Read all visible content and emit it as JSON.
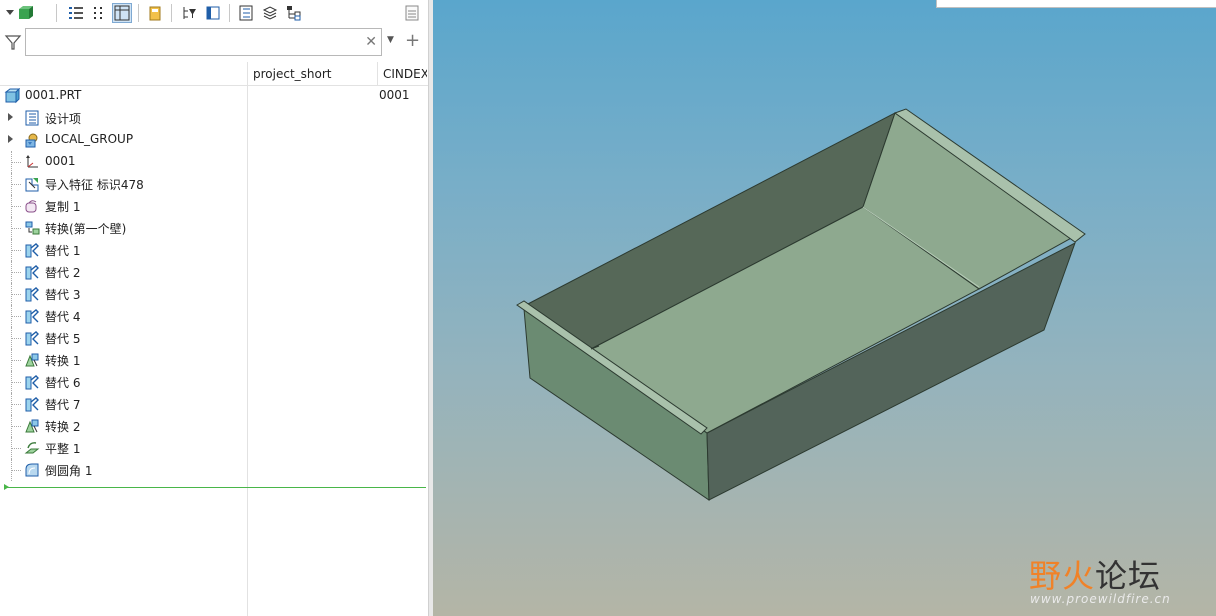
{
  "model_tree": {
    "search": {
      "value": "",
      "placeholder": ""
    },
    "columns": [
      "project_short",
      "CINDEX"
    ],
    "root": {
      "name": "0001.PRT",
      "cindex": "0001"
    },
    "items": [
      {
        "label": "设计项",
        "icon": "design-items-icon",
        "expandable": true
      },
      {
        "label": "LOCAL_GROUP",
        "icon": "group-icon",
        "expandable": true
      },
      {
        "label": "0001",
        "icon": "coordinate-system-icon",
        "expandable": false
      },
      {
        "label": "导入特征 标识478",
        "icon": "import-feature-icon",
        "expandable": false
      },
      {
        "label": "复制 1",
        "icon": "copy-feature-icon",
        "expandable": false
      },
      {
        "label": "转换(第一个壁)",
        "icon": "convert-wall-icon",
        "expandable": false
      },
      {
        "label": "替代 1",
        "icon": "replace-icon",
        "expandable": false
      },
      {
        "label": "替代 2",
        "icon": "replace-icon",
        "expandable": false
      },
      {
        "label": "替代 3",
        "icon": "replace-icon",
        "expandable": false
      },
      {
        "label": "替代 4",
        "icon": "replace-icon",
        "expandable": false
      },
      {
        "label": "替代 5",
        "icon": "replace-icon",
        "expandable": false
      },
      {
        "label": "转换 1",
        "icon": "convert-icon",
        "expandable": false
      },
      {
        "label": "替代 6",
        "icon": "replace-icon",
        "expandable": false
      },
      {
        "label": "替代 7",
        "icon": "replace-icon",
        "expandable": false
      },
      {
        "label": "转换 2",
        "icon": "convert-icon",
        "expandable": false
      },
      {
        "label": "平整 1",
        "icon": "flatten-icon",
        "expandable": false
      },
      {
        "label": "倒圆角 1",
        "icon": "round-icon",
        "expandable": false
      }
    ]
  },
  "watermark": {
    "part1": "野火",
    "part2": "论坛",
    "url": "www.proewildfire.cn"
  },
  "colors": {
    "accent": "#49b649",
    "viewport_top": "#5aa6cc",
    "viewport_bottom": "#b4b5a6",
    "model_face": "#8ea98f",
    "model_dark": "#556a5c"
  }
}
